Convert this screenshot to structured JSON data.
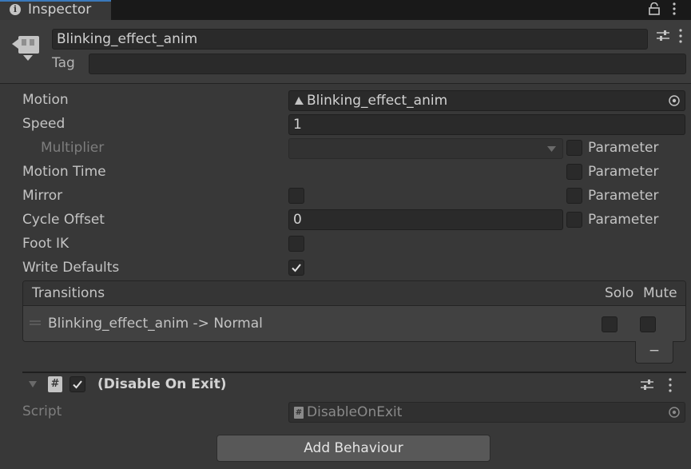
{
  "tab": {
    "title": "Inspector"
  },
  "header": {
    "name": "Blinking_effect_anim",
    "tag_label": "Tag",
    "tag_value": ""
  },
  "properties": {
    "motion_label": "Motion",
    "motion_value": "Blinking_effect_anim",
    "speed_label": "Speed",
    "speed_value": "1",
    "multiplier_label": "Multiplier",
    "motion_time_label": "Motion Time",
    "mirror_label": "Mirror",
    "cycle_offset_label": "Cycle Offset",
    "cycle_offset_value": "0",
    "foot_ik_label": "Foot IK",
    "write_defaults_label": "Write Defaults",
    "parameter_label": "Parameter"
  },
  "transitions": {
    "header": "Transitions",
    "solo_label": "Solo",
    "mute_label": "Mute",
    "rows": [
      {
        "label": "Blinking_effect_anim -> Normal"
      }
    ],
    "remove_label": "−"
  },
  "behaviour": {
    "title": "(Disable On Exit)",
    "script_label": "Script",
    "script_value": "DisableOnExit",
    "add_button": "Add Behaviour"
  }
}
